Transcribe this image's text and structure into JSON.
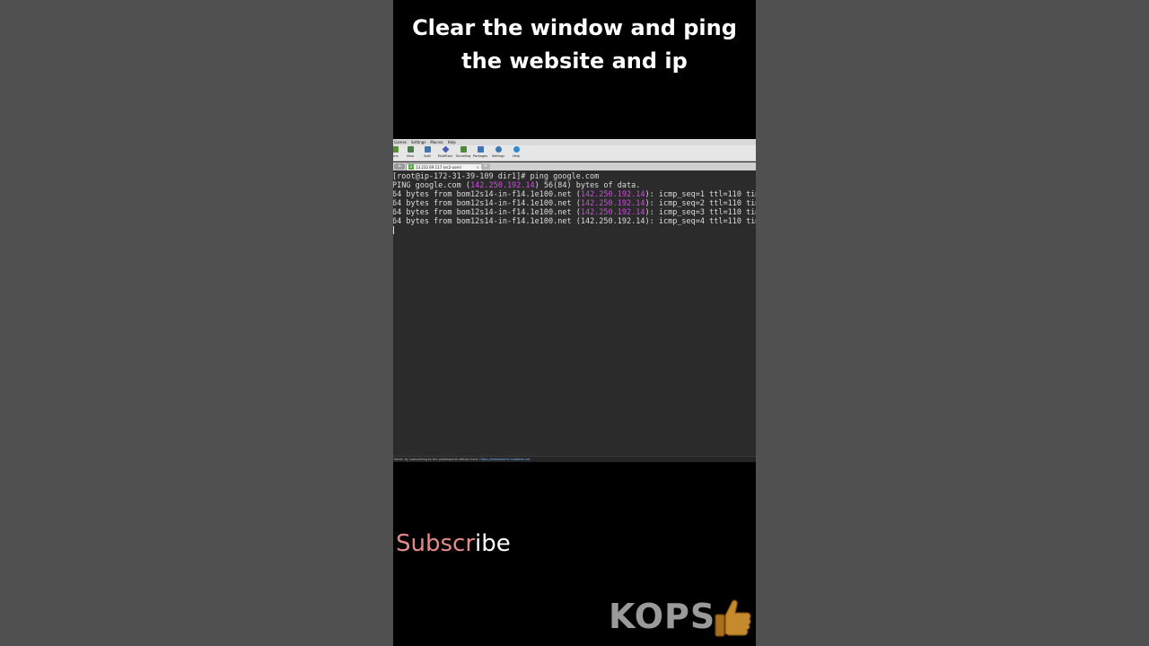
{
  "caption": "Clear the window and ping\nthe website and ip",
  "app": {
    "menu": [
      "Games",
      "Settings",
      "Macros",
      "Help"
    ],
    "toolbar": [
      {
        "label": "ions",
        "icon": "tools-icon",
        "color": "#5a8f3a"
      },
      {
        "label": "View",
        "icon": "monitor-icon",
        "color": "#4a7d4a"
      },
      {
        "label": "Split",
        "icon": "split-icon",
        "color": "#3d76b5"
      },
      {
        "label": "MultiExec",
        "icon": "multiexec-icon",
        "color": "#4a5fb5"
      },
      {
        "label": "Tunneling",
        "icon": "tunneling-icon",
        "color": "#4d8a3a"
      },
      {
        "label": "Packages",
        "icon": "packages-icon",
        "color": "#3d76b5"
      },
      {
        "label": "Settings",
        "icon": "gear-icon",
        "color": "#3d76b5"
      },
      {
        "label": "Help",
        "icon": "help-icon",
        "color": "#2f8ad6"
      }
    ],
    "session_tab": {
      "number": "2",
      "title": "13.232.69.117 (ec2-user)"
    },
    "terminal": {
      "prompt_line": "[root@ip-172-31-39-109 dir1]# ping google.com",
      "ping_header": {
        "prefix": "PING google.com (",
        "ip": "142.250.192.14",
        "suffix": ") 56(84) bytes of data."
      },
      "replies": [
        {
          "prefix": "64 bytes from bom12s14-in-f14.1e100.net (",
          "ip": "142.250.192.14",
          "suffix": "): icmp_seq=1 ttl=110 time=1"
        },
        {
          "prefix": "64 bytes from bom12s14-in-f14.1e100.net (",
          "ip": "142.250.192.14",
          "suffix": "): icmp_seq=2 ttl=110 time=1"
        },
        {
          "prefix": "64 bytes from bom12s14-in-f14.1e100.net (",
          "ip": "142.250.192.14",
          "suffix": "): icmp_seq=3 ttl=110 time=1"
        },
        {
          "prefix": "64 bytes from bom12s14-in-f14.1e100.net (",
          "ip": "142.250.192.14",
          "suffix": "): icmp_seq=4 ttl=110 time=1"
        }
      ]
    },
    "status": {
      "text": "eterm by subscribing to the professional edition here:",
      "link": "https://mobaxterm.mobatek.net"
    }
  },
  "subscribe": {
    "part1": "Subscr",
    "part2": "ibe"
  },
  "logo": "KOPS"
}
